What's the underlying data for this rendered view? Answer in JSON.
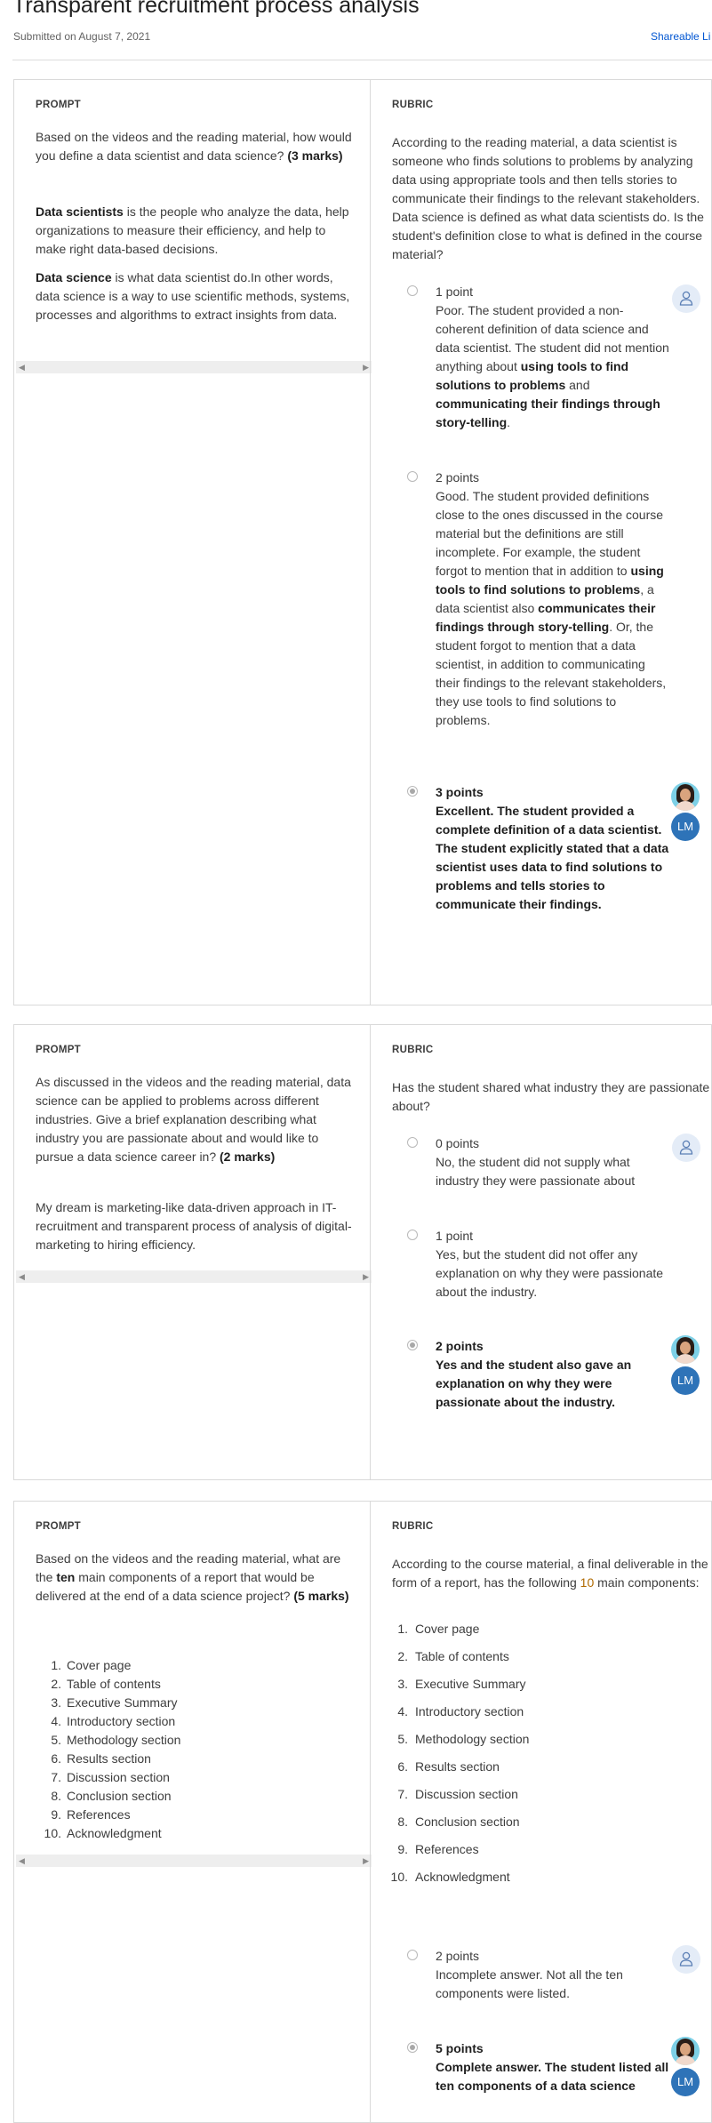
{
  "page": {
    "title": "Transparent recruitment process analysis",
    "submitted": "Submitted on August 7, 2021",
    "share_link": "Shareable Li"
  },
  "labels": {
    "prompt": "PROMPT",
    "rubric": "RUBRIC"
  },
  "q1": {
    "prompt": "Based on the videos and the reading material, how would you define a data scientist and data science?",
    "marks": "(3 marks)",
    "answer1_term": "Data scientists",
    "answer1_rest": " is the people who analyze the data, help organizations to measure their efficiency, and help to make right data-based decisions.",
    "answer2_term": "Data science",
    "answer2_rest": " is what data scientist do.In other words, data science is a way to use scientific methods, systems, processes and algorithms to extract insights from data.",
    "rubric_text": "According to the reading material, a data scientist is someone who finds solutions to problems by analyzing data using appropriate tools and then tells stories to communicate their findings to the relevant stakeholders. Data science is defined as what data scientists do. Is the student's definition close to what is defined in the course material?",
    "options": [
      {
        "points": "1 point",
        "t1": "Poor. The student provided a non-coherent definition of data science and data scientist. The student did not mention anything about ",
        "b1": "using tools to find solutions to problems",
        "t2": " and ",
        "b2": "communicating their findings through story-telling",
        "t3": "."
      },
      {
        "points": "2 points",
        "t1": "Good. The student provided definitions close to the ones discussed in the course material but the definitions are still incomplete. For example, the student forgot to mention that in addition to ",
        "b1": "using tools to find solutions to problems",
        "t2": ", a data scientist also ",
        "b2": "communicates their findings through story-telling",
        "t3": ". Or, the student forgot to mention that a data scientist, in addition to communicating their findings to the relevant stakeholders, they use tools to find solutions to problems."
      },
      {
        "points": "3 points",
        "text": "Excellent. The student provided a complete definition of a data scientist. The student explicitly stated that a data scientist uses data to find solutions to problems and tells stories to communicate their findings."
      }
    ]
  },
  "q2": {
    "prompt": "As discussed in the videos and the reading material, data science can be applied to problems across different industries. Give a brief explanation describing what industry  you are passionate about and would like to pursue a data science career in?",
    "marks": "(2 marks)",
    "answer": "My dream is marketing-like data-driven approach in IT-recruitment and transparent process of analysis of digital-marketing to hiring efficiency.",
    "rubric_text": "Has the student shared what industry they are passionate about?",
    "options": [
      {
        "points": "0 points",
        "text": "No, the student did not supply what industry they were passionate about"
      },
      {
        "points": "1 point",
        "text": "Yes, but the student did not offer any explanation on why they were passionate about the industry."
      },
      {
        "points": "2 points",
        "text": "Yes and the student also gave an explanation on why they were passionate about the industry."
      }
    ]
  },
  "q3": {
    "prompt_a": "Based on the videos and the reading material, what are the ",
    "prompt_bold": "ten",
    "prompt_b": " main components of a report that would be delivered at the end of a data science project?",
    "marks": "(5 marks)",
    "answer_list": [
      "Cover page",
      "Table of contents",
      "Executive Summary",
      "Introductory section",
      "Methodology section",
      "Results section",
      "Discussion section",
      "Conclusion section",
      "References",
      "Acknowledgment"
    ],
    "rubric_a": "According to the course material, a final deliverable in the form of a report, has the following ",
    "rubric_num": "10",
    "rubric_b": " main components:",
    "rubric_list": [
      "Cover page",
      "Table of contents",
      "Executive Summary",
      "Introductory section",
      "Methodology section",
      "Results section",
      "Discussion section",
      "Conclusion section",
      "References",
      "Acknowledgment"
    ],
    "options": [
      {
        "points": "2 points",
        "text": "Incomplete answer. Not all the ten components were listed."
      },
      {
        "points": "5 points",
        "text": "Complete answer. The student listed all ten components of a data science"
      }
    ]
  },
  "grader": {
    "initials": "LM"
  },
  "colors": {
    "link": "#0056d2",
    "grader_badge": "#2e73b8",
    "empty_avatar": "#e4ecf7"
  },
  "icons": {
    "empty_avatar": "user-outline-icon",
    "scroll_left": "left-arrow-icon",
    "scroll_right": "right-arrow-icon"
  }
}
